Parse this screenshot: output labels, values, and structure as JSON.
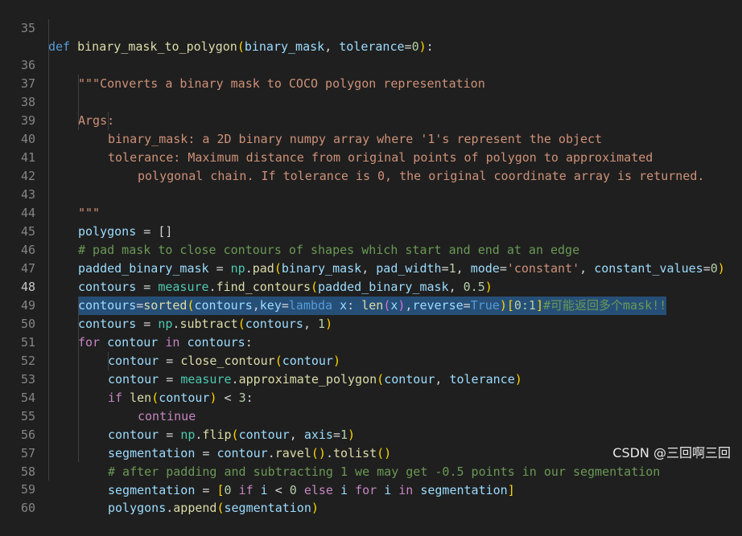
{
  "editor": {
    "line_numbers": [
      "35",
      "36",
      "37",
      "38",
      "39",
      "40",
      "41",
      "42",
      "43",
      "44",
      "45",
      "46",
      "47",
      "48",
      "49",
      "50",
      "51",
      "52",
      "53",
      "54",
      "55",
      "56",
      "57",
      "58",
      "59",
      "60"
    ],
    "active_line": "48"
  },
  "code": {
    "l35": {
      "def": "def",
      "name": "binary_mask_to_polygon",
      "p1": "binary_mask",
      "p2": "tolerance",
      "zero": "0"
    },
    "l36": "\"\"\"Converts a binary mask to COCO polygon representation",
    "l38": "Args:",
    "l39": "binary_mask: a 2D binary numpy array where '1's represent the object",
    "l40": "tolerance: Maximum distance from original points of polygon to approximated",
    "l41": "polygonal chain. If tolerance is 0, the original coordinate array is returned.",
    "l43": "\"\"\"",
    "l44": {
      "var": "polygons",
      "rest": " = []"
    },
    "l45": "# pad mask to close contours of shapes which start and end at an edge",
    "l46": {
      "var": "padded_binary_mask",
      "np": "np",
      "fn": "pad",
      "a1": "binary_mask",
      "kw1": "pad_width",
      "n1": "1",
      "kw2": "mode",
      "s1": "'constant'",
      "kw3": "constant_values",
      "n2": "0"
    },
    "l47": {
      "var": "contours",
      "mod": "measure",
      "fn": "find_contours",
      "a1": "padded_binary_mask",
      "n1": "0.5"
    },
    "l48": {
      "var": "contours",
      "fn": "sorted",
      "a1": "contours",
      "kw1": "key",
      "lam": "lambda",
      "x": "x",
      "len": "len",
      "kw2": "reverse",
      "tru": "True",
      "slice": "0:1",
      "comment": "#可能返回多个mask!!"
    },
    "l49": {
      "var": "contours",
      "np": "np",
      "fn": "subtract",
      "a1": "contours",
      "n1": "1"
    },
    "l50": {
      "for": "for",
      "v": "contour",
      "in": "in",
      "it": "contours"
    },
    "l51": {
      "var": "contour",
      "fn": "close_contour",
      "a1": "contour"
    },
    "l52": {
      "var": "contour",
      "mod": "measure",
      "fn": "approximate_polygon",
      "a1": "contour",
      "a2": "tolerance"
    },
    "l53": {
      "if": "if",
      "fn": "len",
      "a1": "contour",
      "n1": "3"
    },
    "l54": "continue",
    "l55": {
      "var": "contour",
      "np": "np",
      "fn": "flip",
      "a1": "contour",
      "kw1": "axis",
      "n1": "1"
    },
    "l56": {
      "var": "segmentation",
      "obj": "contour",
      "fn1": "ravel",
      "fn2": "tolist"
    },
    "l57": "# after padding and subtracting 1 we may get -0.5 points in our segmentation",
    "l58": {
      "var": "segmentation",
      "n0": "0",
      "if": "if",
      "i": "i",
      "lt": "<",
      "n1": "0",
      "else": "else",
      "for": "for",
      "in": "in",
      "it": "segmentation"
    },
    "l59": {
      "obj": "polygons",
      "fn": "append",
      "a1": "segmentation"
    }
  },
  "watermark": "CSDN @三回啊三回",
  "colors": {
    "background": "#1f1f1f",
    "selection": "#264f78",
    "keyword": "#569cd6",
    "function": "#dcdcaa",
    "variable": "#9cdcfe",
    "string": "#ce9178",
    "number": "#b5cea8",
    "comment": "#6a9955"
  }
}
